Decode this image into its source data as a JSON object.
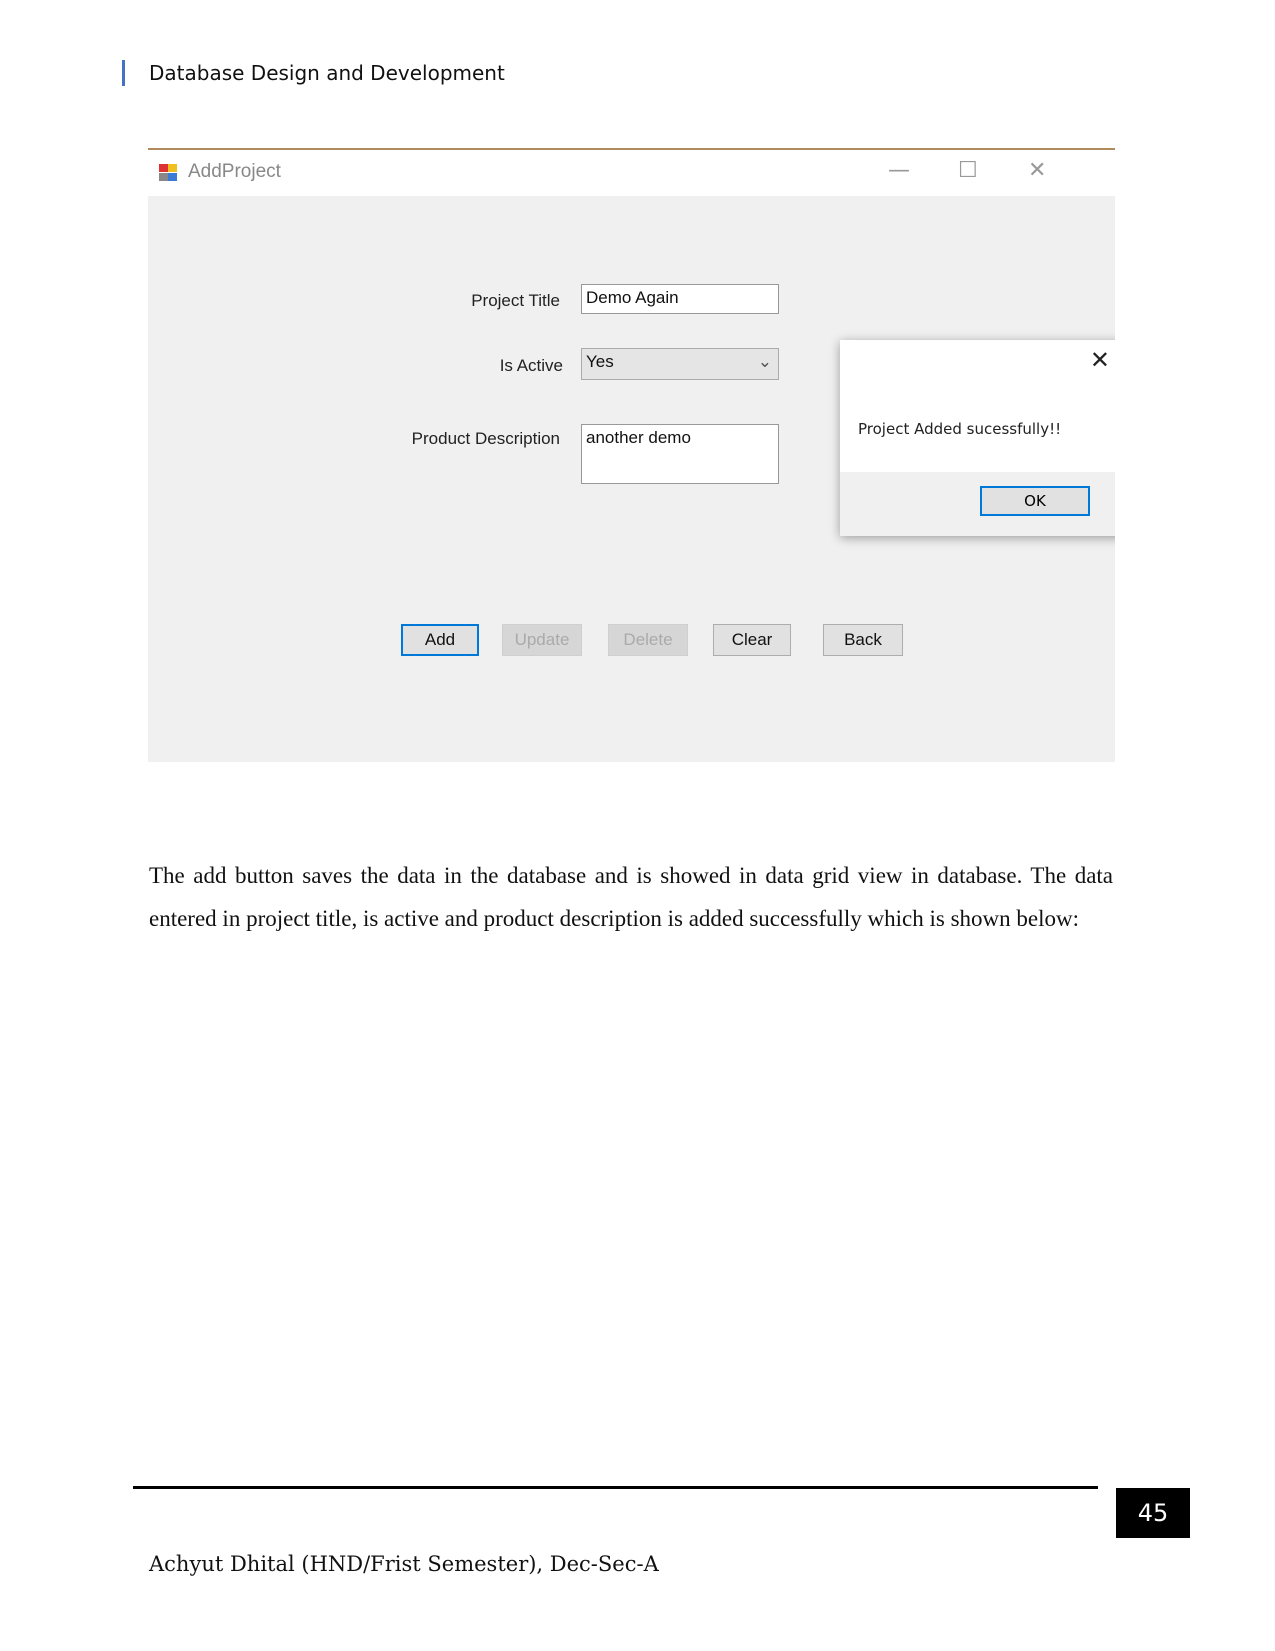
{
  "header": {
    "title": "Database Design and Development"
  },
  "window": {
    "title": "AddProject",
    "icons": {
      "app": "app-form-icon",
      "minimize": "minimize-icon",
      "maximize": "maximize-icon",
      "close": "close-icon"
    },
    "form": {
      "project_title_label": "Project Title",
      "project_title_value": "Demo Again",
      "is_active_label": "Is Active",
      "is_active_value": "Yes",
      "description_label": "Product Description",
      "description_value": "another demo"
    },
    "buttons": {
      "add": "Add",
      "update": "Update",
      "delete": "Delete",
      "clear": "Clear",
      "back": "Back"
    },
    "dialog": {
      "message": "Project Added sucessfully!!",
      "ok": "OK"
    }
  },
  "body": {
    "paragraph": "The add button saves the data in the database and is showed in data grid view in database. The data entered in project title, is active and product description is added successfully which is shown below:"
  },
  "footer": {
    "page_number": "45",
    "author": "Achyut Dhital (HND/Frist Semester), Dec-Sec-A"
  },
  "colors": {
    "accent": "#0078d7",
    "header_bar": "#4472c4"
  }
}
